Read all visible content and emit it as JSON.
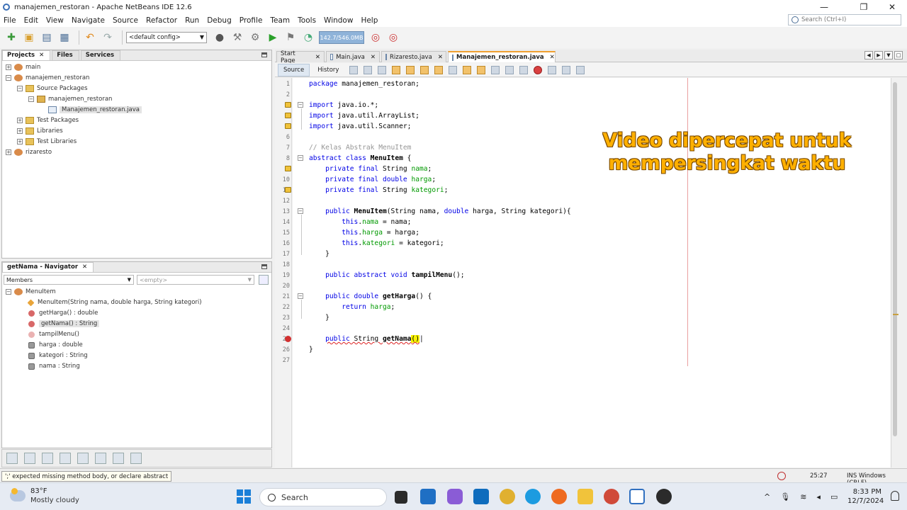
{
  "window": {
    "title": "manajemen_restoran - Apache NetBeans IDE 12.6",
    "controls": [
      "—",
      "❐",
      "✕"
    ]
  },
  "menu": [
    "File",
    "Edit",
    "View",
    "Navigate",
    "Source",
    "Refactor",
    "Run",
    "Debug",
    "Profile",
    "Team",
    "Tools",
    "Window",
    "Help"
  ],
  "search": {
    "placeholder": "Search (Ctrl+I)"
  },
  "toolbar": {
    "config": "<default config>",
    "memory": "142.7/546.0MB"
  },
  "projects_panel": {
    "tabs": [
      "Projects",
      "Files",
      "Services"
    ],
    "tree": [
      {
        "label": "main",
        "level": 0,
        "expander": "+",
        "icon": "project"
      },
      {
        "label": "manajemen_restoran",
        "level": 0,
        "expander": "−",
        "icon": "project"
      },
      {
        "label": "Source Packages",
        "level": 1,
        "expander": "−",
        "icon": "folder"
      },
      {
        "label": "manajemen_restoran",
        "level": 2,
        "expander": "−",
        "icon": "package"
      },
      {
        "label": "Manajemen_restoran.java",
        "level": 3,
        "expander": "",
        "icon": "java",
        "selected": true
      },
      {
        "label": "Test Packages",
        "level": 1,
        "expander": "+",
        "icon": "folder"
      },
      {
        "label": "Libraries",
        "level": 1,
        "expander": "+",
        "icon": "folder"
      },
      {
        "label": "Test Libraries",
        "level": 1,
        "expander": "+",
        "icon": "folder"
      },
      {
        "label": "rizaresto",
        "level": 0,
        "expander": "+",
        "icon": "project"
      }
    ]
  },
  "navigator_panel": {
    "title": "getNama - Navigator",
    "filter": "Members",
    "filter2": "<empty>",
    "tree": [
      {
        "label": "MenuItem",
        "level": 0,
        "kind": "class"
      },
      {
        "label": "MenuItem(String nama, double harga, String kategori)",
        "level": 1,
        "kind": "ctor"
      },
      {
        "label": "getHarga() : double",
        "level": 1,
        "kind": "method"
      },
      {
        "label": "getNama() : String",
        "level": 1,
        "kind": "method",
        "selected": true
      },
      {
        "label": "tampilMenu()",
        "level": 1,
        "kind": "abstract"
      },
      {
        "label": "harga : double",
        "level": 1,
        "kind": "field"
      },
      {
        "label": "kategori : String",
        "level": 1,
        "kind": "field"
      },
      {
        "label": "nama : String",
        "level": 1,
        "kind": "field"
      }
    ]
  },
  "editor": {
    "tabs": [
      {
        "label": "Start Page",
        "active": false
      },
      {
        "label": "Main.java",
        "active": false
      },
      {
        "label": "Rizaresto.java",
        "active": false
      },
      {
        "label": "Manajemen_restoran.java",
        "active": true
      }
    ],
    "source_tab": "Source",
    "history_tab": "History",
    "line_numbers": [
      "1",
      "2",
      "3",
      "4",
      "5",
      "6",
      "7",
      "8",
      "9",
      "10",
      "11",
      "12",
      "13",
      "14",
      "15",
      "16",
      "17",
      "18",
      "19",
      "20",
      "21",
      "22",
      "23",
      "24",
      "25",
      "26",
      "27"
    ],
    "overlay_text": [
      "Video dipercepat untuk",
      "mempersingkat waktu"
    ]
  },
  "status": {
    "message": "';' expected  missing method body, or declare abstract",
    "position": "25:27",
    "mode": "INS  Windows (CRLF)"
  },
  "taskbar": {
    "temperature": "83°F",
    "weather": "Mostly cloudy",
    "search_label": "Search",
    "time": "8:33 PM",
    "date": "12/7/2024"
  },
  "colors": {
    "keyword": "#0000e6",
    "field": "#009900",
    "comment": "#969696",
    "overlay": "#ffb000"
  }
}
